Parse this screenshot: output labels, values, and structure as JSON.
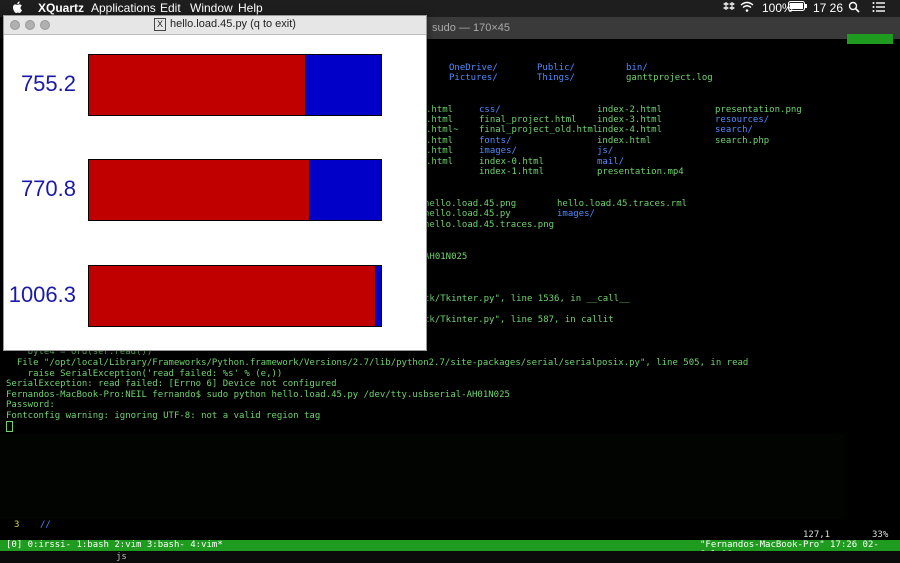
{
  "menubar": {
    "apple": "",
    "app": "XQuartz",
    "items": [
      "Applications",
      "Edit",
      "Window",
      "Help"
    ],
    "battery": "100%",
    "time": "17 26"
  },
  "terminal": {
    "title": "sudo — 170×45",
    "ls_rows": [
      [
        "OneDrive/",
        "Public/",
        "bin/"
      ],
      [
        "Pictures/",
        "Things/",
        "ganttproject.log"
      ]
    ],
    "ls_html": [
      [
        ".html",
        "css/",
        "index-2.html",
        "presentation.png"
      ],
      [
        ".html",
        "final_project.html",
        "index-3.html",
        "resources/"
      ],
      [
        ".html~",
        "final_project_old.html",
        "index-4.html",
        "search/"
      ],
      [
        ".html",
        "fonts/",
        "index.html",
        "search.php"
      ],
      [
        ".html",
        "images/",
        "js/",
        ""
      ],
      [
        ".html",
        "index-0.html",
        "mail/",
        ""
      ],
      [
        "",
        "index-1.html",
        "presentation.mp4",
        ""
      ]
    ],
    "ls_hello": [
      [
        "hello.load.45.png",
        "hello.load.45.traces.rml"
      ],
      [
        "hello.load.45.py",
        "images/"
      ],
      [
        "hello.load.45.traces.png",
        ""
      ]
    ],
    "device_frag": "AH01N025",
    "tk1": "tk/Tkinter.py\", line 1536, in __call__",
    "tk2": "tk/Tkinter.py\", line 587, in callit",
    "lines": [
      "    byte4 = ord(ser.read())",
      "  File \"/opt/local/Library/Frameworks/Python.framework/Versions/2.7/lib/python2.7/site-packages/serial/serialposix.py\", line 505, in read",
      "    raise SerialException('read failed: %s' % (e,))",
      "SerialException: read failed: [Errno 6] Device not configured",
      "Fernandos-MacBook-Pro:NEIL fernando$ sudo python hello.load.45.py /dev/tty.usbserial-AH01N025",
      "Password:",
      "Fontconfig warning: ignoring UTF-8: not a valid region tag"
    ],
    "vim_line_num": "3",
    "vim_line_text": "//",
    "vim_pos": "127,1",
    "vim_pct": "33%",
    "status_left": "[0] 0:irssi- 1:bash  2:vim  3:bash- 4:vim*",
    "status_right": "\"Fernandos-MacBook-Pro\" 17:26 02-Jul-18",
    "bottom_text": "js"
  },
  "window": {
    "title": "hello.load.45.py (q to exit)",
    "x_icon": "X"
  },
  "chart_data": {
    "type": "bar",
    "orientation": "horizontal",
    "labels": [
      "755.2",
      "770.8",
      "1006.3"
    ],
    "fractions": [
      0.74,
      0.755,
      0.98
    ],
    "colors": {
      "fill": "#c00000",
      "remainder": "#0000c8"
    }
  }
}
